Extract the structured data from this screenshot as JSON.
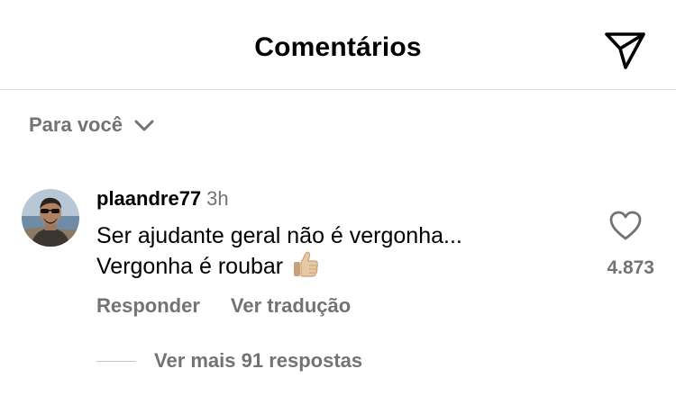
{
  "header": {
    "title": "Comentários",
    "send_icon": "paper-plane-icon"
  },
  "filter": {
    "label": "Para você",
    "icon": "chevron-down-icon"
  },
  "comment": {
    "username": "plaandre77",
    "time": "3h",
    "text_line1": "Ser ajudante geral não é vergonha...",
    "text_line2": "Vergonha é roubar",
    "emoji": "thumbs-up",
    "like_count": "4.873",
    "actions": {
      "reply": "Responder",
      "translate": "Ver tradução"
    },
    "replies": {
      "label": "Ver mais 91 respostas"
    }
  },
  "colors": {
    "text": "#000000",
    "secondary": "#737373",
    "divider": "#dbdbdb",
    "background": "#ffffff"
  }
}
